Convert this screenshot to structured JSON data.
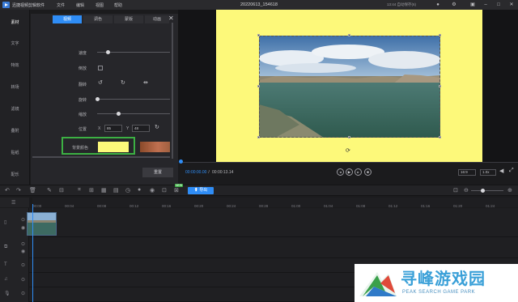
{
  "app": {
    "title": "迅捷视频剪辑软件",
    "menu": [
      "文件",
      "编辑",
      "视图",
      "帮助"
    ],
    "filename": "20220613_154618",
    "status": "13:44 自动保存(6)"
  },
  "left_nav": [
    "素材",
    "文字",
    "特效",
    "转场",
    "滤镜",
    "叠附",
    "贴纸",
    "配乐"
  ],
  "panel": {
    "tabs": [
      "视频",
      "调色",
      "蒙版",
      "动画"
    ],
    "labels": {
      "speed": "速度",
      "reverse": "倒放",
      "flip": "翻转",
      "rotate": "旋转",
      "scale": "缩放",
      "position": "位置",
      "pos_x_label": "X",
      "pos_x_value": "85",
      "pos_y_label": "Y",
      "pos_y_value": "48",
      "bg_color": "背景颜色"
    },
    "reset": "重置",
    "bg_color_value": "#fdf97a"
  },
  "player": {
    "current_time": "00:00:00.00",
    "separator": " / ",
    "total_time": "00:00:13.14",
    "ratio": "16:9",
    "speed": "1.0x"
  },
  "toolbar": {
    "export": "导出",
    "new_badge": "NEW"
  },
  "timeline": {
    "ticks": [
      "00:00",
      "00:04",
      "00:08",
      "00:12",
      "00:16",
      "00:20",
      "00:24",
      "00:28",
      "01:00",
      "01:04",
      "01:08",
      "01:12",
      "01:16",
      "01:20",
      "01:24"
    ]
  },
  "watermark": {
    "main": "寻峰游戏园",
    "sub": "PEAK SEARCH GAME PARK"
  }
}
